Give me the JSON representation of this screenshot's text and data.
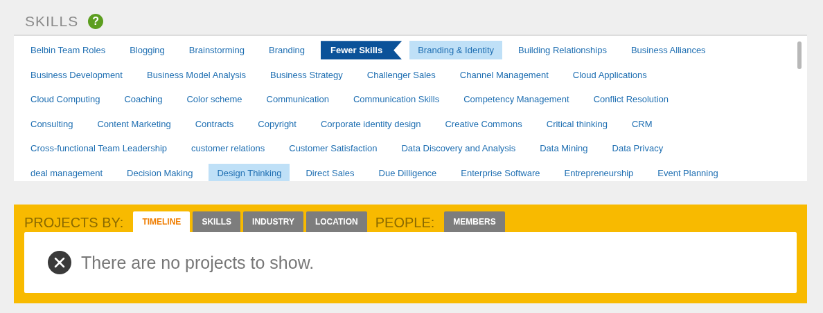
{
  "skills": {
    "title": "SKILLS",
    "help": "?",
    "rows": [
      {
        "items": [
          {
            "label": "Belbin Team Roles",
            "kind": "skill",
            "selected": false
          },
          {
            "label": "Blogging",
            "kind": "skill",
            "selected": false
          },
          {
            "label": "Brainstorming",
            "kind": "skill",
            "selected": false
          },
          {
            "label": "Branding",
            "kind": "skill",
            "selected": false
          },
          {
            "label": "Fewer Skills",
            "kind": "toggle"
          },
          {
            "label": "Branding & Identity",
            "kind": "skill",
            "selected": true
          },
          {
            "label": "Building Relationships",
            "kind": "skill",
            "selected": false
          },
          {
            "label": "Business Alliances",
            "kind": "skill",
            "selected": false
          }
        ]
      },
      {
        "items": [
          {
            "label": "Business Development",
            "kind": "skill",
            "selected": false
          },
          {
            "label": "Business Model Analysis",
            "kind": "skill",
            "selected": false
          },
          {
            "label": "Business Strategy",
            "kind": "skill",
            "selected": false
          },
          {
            "label": "Challenger Sales",
            "kind": "skill",
            "selected": false
          },
          {
            "label": "Channel Management",
            "kind": "skill",
            "selected": false
          },
          {
            "label": "Cloud Applications",
            "kind": "skill",
            "selected": false
          }
        ]
      },
      {
        "items": [
          {
            "label": "Cloud Computing",
            "kind": "skill",
            "selected": false
          },
          {
            "label": "Coaching",
            "kind": "skill",
            "selected": false
          },
          {
            "label": "Color scheme",
            "kind": "skill",
            "selected": false
          },
          {
            "label": "Communication",
            "kind": "skill",
            "selected": false
          },
          {
            "label": "Communication Skills",
            "kind": "skill",
            "selected": false
          },
          {
            "label": "Competency Management",
            "kind": "skill",
            "selected": false
          },
          {
            "label": "Conflict Resolution",
            "kind": "skill",
            "selected": false
          }
        ]
      },
      {
        "items": [
          {
            "label": "Consulting",
            "kind": "skill",
            "selected": false
          },
          {
            "label": "Content Marketing",
            "kind": "skill",
            "selected": false
          },
          {
            "label": "Contracts",
            "kind": "skill",
            "selected": false
          },
          {
            "label": "Copyright",
            "kind": "skill",
            "selected": false
          },
          {
            "label": "Corporate identity design",
            "kind": "skill",
            "selected": false
          },
          {
            "label": "Creative Commons",
            "kind": "skill",
            "selected": false
          },
          {
            "label": "Critical thinking",
            "kind": "skill",
            "selected": false
          },
          {
            "label": "CRM",
            "kind": "skill",
            "selected": false
          }
        ]
      },
      {
        "items": [
          {
            "label": "Cross-functional Team Leadership",
            "kind": "skill",
            "selected": false
          },
          {
            "label": "customer relations",
            "kind": "skill",
            "selected": false
          },
          {
            "label": "Customer Satisfaction",
            "kind": "skill",
            "selected": false
          },
          {
            "label": "Data Discovery and Analysis",
            "kind": "skill",
            "selected": false
          },
          {
            "label": "Data Mining",
            "kind": "skill",
            "selected": false
          },
          {
            "label": "Data Privacy",
            "kind": "skill",
            "selected": false
          }
        ]
      },
      {
        "items": [
          {
            "label": "deal management",
            "kind": "skill",
            "selected": false
          },
          {
            "label": "Decision Making",
            "kind": "skill",
            "selected": false
          },
          {
            "label": "Design Thinking",
            "kind": "skill",
            "selected": true
          },
          {
            "label": "Direct Sales",
            "kind": "skill",
            "selected": false
          },
          {
            "label": "Due Dilligence",
            "kind": "skill",
            "selected": false
          },
          {
            "label": "Enterprise Software",
            "kind": "skill",
            "selected": false
          },
          {
            "label": "Entrepreneurship",
            "kind": "skill",
            "selected": false
          },
          {
            "label": "Event Planning",
            "kind": "skill",
            "selected": false
          }
        ]
      }
    ]
  },
  "projects": {
    "tab_groups": [
      {
        "label": "PROJECTS BY:",
        "tabs": [
          {
            "label": "TIMELINE",
            "selected": true
          },
          {
            "label": "SKILLS",
            "selected": false
          },
          {
            "label": "INDUSTRY",
            "selected": false
          },
          {
            "label": "LOCATION",
            "selected": false
          }
        ]
      },
      {
        "label": "PEOPLE:",
        "tabs": [
          {
            "label": "MEMBERS",
            "selected": false
          }
        ]
      }
    ],
    "message": "There are no projects to show."
  }
}
